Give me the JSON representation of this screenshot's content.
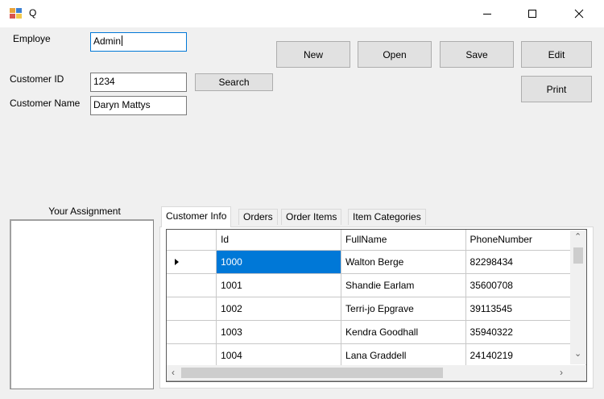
{
  "window": {
    "title": "Q"
  },
  "form": {
    "employee_label": "Employe",
    "employee_value": "Admin",
    "customer_id_label": "Customer ID",
    "customer_id_value": "1234",
    "customer_name_label": "Customer Name",
    "customer_name_value": "Daryn Mattys",
    "search_label": "Search"
  },
  "toolbar": {
    "new_label": "New",
    "open_label": "Open",
    "save_label": "Save",
    "edit_label": "Edit",
    "print_label": "Print"
  },
  "assignment": {
    "label": "Your Assignment"
  },
  "tabs": [
    "Customer Info",
    "Orders",
    "Order Items",
    "Item Categories"
  ],
  "grid": {
    "columns": [
      "Id",
      "FullName",
      "PhoneNumber"
    ],
    "rows": [
      [
        "1000",
        "Walton Berge",
        "82298434"
      ],
      [
        "1001",
        "Shandie Earlam",
        "35600708"
      ],
      [
        "1002",
        "Terri-jo Epgrave",
        "39113545"
      ],
      [
        "1003",
        "Kendra Goodhall",
        "35940322"
      ],
      [
        "1004",
        "Lana Graddell",
        "24140219"
      ]
    ]
  },
  "colors": {
    "selection": "#0078d7",
    "focus_border": "#0078d7"
  }
}
